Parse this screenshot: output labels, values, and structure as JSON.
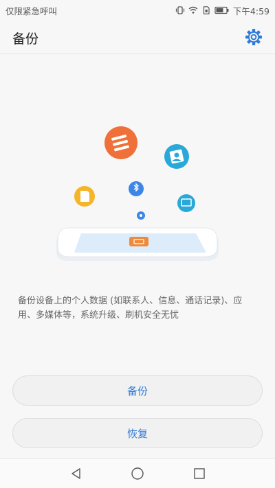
{
  "status_bar": {
    "carrier_text": "仅限紧急呼叫",
    "time": "下午4:59",
    "icons": [
      "vibrate-icon",
      "wifi-icon",
      "sim-icon",
      "battery-icon"
    ]
  },
  "app_bar": {
    "title": "备份",
    "settings_icon": "gear-icon"
  },
  "illustration": {
    "icons": [
      "orange-list-icon",
      "cyan-contacts-icon",
      "yellow-sd-icon",
      "blue-bluetooth-icon",
      "cyan-display-icon",
      "blue-dot-icon"
    ],
    "colors": {
      "orange": "#f0703a",
      "cyan": "#2aa9d8",
      "yellow": "#f5b52a",
      "blue": "#3b86e6"
    }
  },
  "description": "备份设备上的个人数据 (如联系人、信息、通话记录)、应用、多媒体等，系统升级、刷机安全无忧",
  "buttons": {
    "backup_label": "备份",
    "restore_label": "恢复"
  },
  "nav_bar": {
    "icons": [
      "back-icon",
      "home-icon",
      "recents-icon"
    ]
  },
  "colors": {
    "accent": "#2f7bd8",
    "background": "#f7f7f7"
  }
}
